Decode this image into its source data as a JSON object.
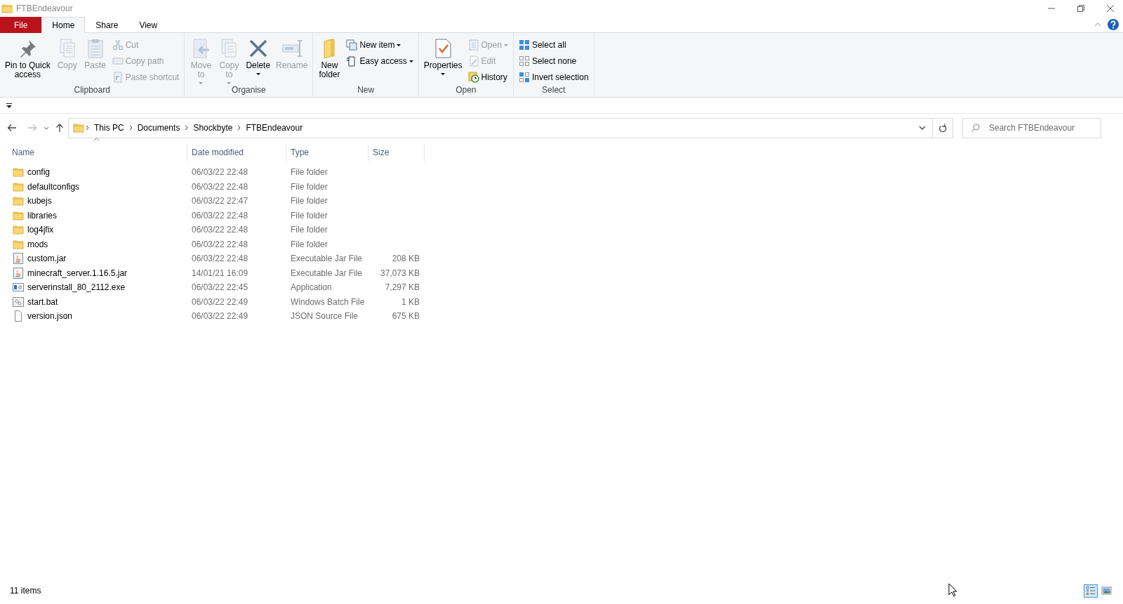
{
  "window": {
    "title": "FTBEndeavour"
  },
  "ribbon_tabs": [
    {
      "label": "File",
      "kind": "file",
      "selected": false
    },
    {
      "label": "Home",
      "kind": "tab",
      "selected": true
    },
    {
      "label": "Share",
      "kind": "tab",
      "selected": false
    },
    {
      "label": "View",
      "kind": "tab",
      "selected": false
    }
  ],
  "ribbon_groups": [
    {
      "label": "Clipboard",
      "commands": [
        {
          "label": "Pin to Quick\naccess",
          "kind": "large",
          "disabled": false,
          "dropdown": false
        },
        {
          "label": "Copy",
          "kind": "large",
          "disabled": true,
          "dropdown": false
        },
        {
          "label": "Paste",
          "kind": "large",
          "disabled": true,
          "dropdown": false
        },
        {
          "label": "Cut",
          "kind": "small",
          "disabled": true,
          "dropdown": false
        },
        {
          "label": "Copy path",
          "kind": "small",
          "disabled": true,
          "dropdown": false
        },
        {
          "label": "Paste shortcut",
          "kind": "small",
          "disabled": true,
          "dropdown": false
        }
      ]
    },
    {
      "label": "Organise",
      "commands": [
        {
          "label": "Move\nto",
          "kind": "large",
          "disabled": true,
          "dropdown": true
        },
        {
          "label": "Copy\nto",
          "kind": "large",
          "disabled": true,
          "dropdown": true
        },
        {
          "label": "Delete",
          "kind": "large",
          "disabled": false,
          "dropdown": true
        },
        {
          "label": "Rename",
          "kind": "large",
          "disabled": true,
          "dropdown": false
        }
      ]
    },
    {
      "label": "New",
      "commands": [
        {
          "label": "New\nfolder",
          "kind": "large",
          "disabled": false,
          "dropdown": false
        },
        {
          "label": "New item",
          "kind": "small",
          "disabled": false,
          "dropdown": true
        },
        {
          "label": "Easy access",
          "kind": "small",
          "disabled": false,
          "dropdown": true
        }
      ]
    },
    {
      "label": "Open",
      "commands": [
        {
          "label": "Properties",
          "kind": "large",
          "disabled": false,
          "dropdown": true
        },
        {
          "label": "Open",
          "kind": "small",
          "disabled": true,
          "dropdown": true
        },
        {
          "label": "Edit",
          "kind": "small",
          "disabled": true,
          "dropdown": false
        },
        {
          "label": "History",
          "kind": "small",
          "disabled": false,
          "dropdown": false
        }
      ]
    },
    {
      "label": "Select",
      "commands": [
        {
          "label": "Select all",
          "kind": "small",
          "disabled": false,
          "dropdown": false
        },
        {
          "label": "Select none",
          "kind": "small",
          "disabled": false,
          "dropdown": false
        },
        {
          "label": "Invert selection",
          "kind": "small",
          "disabled": false,
          "dropdown": false
        }
      ]
    }
  ],
  "breadcrumbs": [
    "This PC",
    "Documents",
    "Shockbyte",
    "FTBEndeavour"
  ],
  "search": {
    "placeholder": "Search FTBEndeavour"
  },
  "columns": [
    {
      "label": "Name",
      "sorted": true
    },
    {
      "label": "Date modified",
      "sorted": false
    },
    {
      "label": "Type",
      "sorted": false
    },
    {
      "label": "Size",
      "sorted": false
    }
  ],
  "rows": [
    {
      "name": "config",
      "date": "06/03/22 22:48",
      "type": "File folder",
      "kind": "folder"
    },
    {
      "name": "defaultconfigs",
      "date": "06/03/22 22:48",
      "type": "File folder",
      "kind": "folder"
    },
    {
      "name": "kubejs",
      "date": "06/03/22 22:47",
      "type": "File folder",
      "kind": "folder"
    },
    {
      "name": "libraries",
      "date": "06/03/22 22:48",
      "type": "File folder",
      "kind": "folder"
    },
    {
      "name": "log4jfix",
      "date": "06/03/22 22:48",
      "type": "File folder",
      "kind": "folder"
    },
    {
      "name": "mods",
      "date": "06/03/22 22:48",
      "type": "File folder",
      "kind": "folder"
    },
    {
      "name": "custom.jar",
      "date": "06/03/22 22:48",
      "type": "Executable Jar File",
      "size": "208 KB",
      "kind": "jar"
    },
    {
      "name": "minecraft_server.1.16.5.jar",
      "date": "14/01/21 16:09",
      "type": "Executable Jar File",
      "size": "37,073 KB",
      "kind": "jar"
    },
    {
      "name": "serverinstall_80_2112.exe",
      "date": "06/03/22 22:45",
      "type": "Application",
      "size": "7,297 KB",
      "kind": "exe"
    },
    {
      "name": "start.bat",
      "date": "06/03/22 22:49",
      "type": "Windows Batch File",
      "size": "1 KB",
      "kind": "bat"
    },
    {
      "name": "version.json",
      "date": "06/03/22 22:49",
      "type": "JSON Source File",
      "size": "675 KB",
      "kind": "file"
    }
  ],
  "status_bar": {
    "item_count": "11 items"
  },
  "view_buttons": [
    {
      "kind": "details",
      "selected": true
    },
    {
      "kind": "large_icons",
      "selected": false
    }
  ]
}
